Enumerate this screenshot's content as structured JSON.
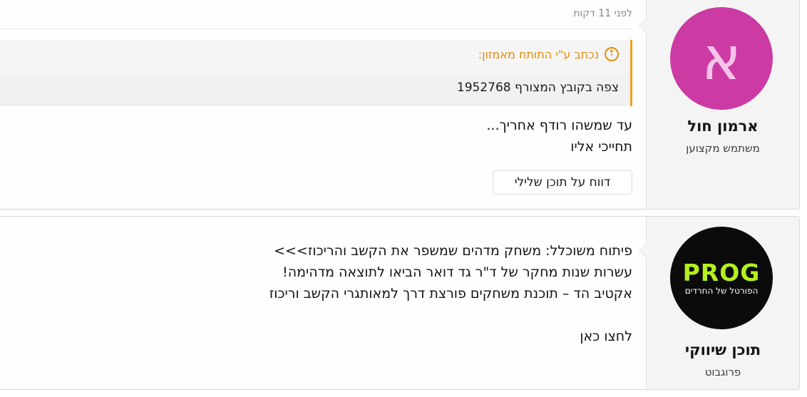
{
  "posts": [
    {
      "author": {
        "initial": "א",
        "name": "ארמון חול",
        "title": "משתמש מקצוען",
        "avatar_color": "#cc3aa3"
      },
      "timestamp": "לפני 11 דקות",
      "quote": {
        "header": "נכתב ע\"י התותח מאמזון:",
        "body": "צפה בקובץ המצורף 1952768"
      },
      "lines": [
        "עד שמשהו רודף אחריך...",
        "תחייכי אליו"
      ],
      "report_label": "דווח על תוכן שלילי"
    },
    {
      "author": {
        "logo_text": "PROG",
        "logo_sub": "הפורטל של החרדים",
        "name": "תוכן שיווקי",
        "title": "פרוגבוט",
        "logo_color": "#b4f01e"
      },
      "lines": [
        "פיתוח משוכלל: משחק מדהים שמשפר את הקשב והריכוז>>>",
        "עשרות שנות מחקר של ד\"ר גד דואר הביאו לתוצאה מדהימה!",
        "אקטיב הד – תוכנת משחקים פורצת דרך למאותגרי הקשב וריכוז",
        "",
        "לחצו כאן"
      ]
    }
  ]
}
